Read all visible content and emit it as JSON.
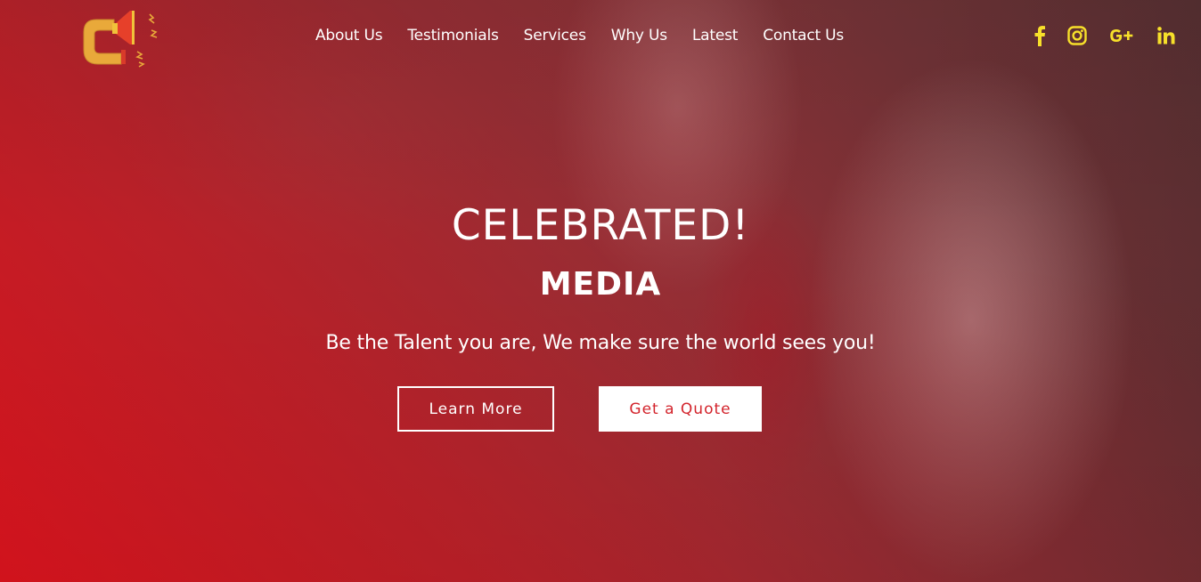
{
  "brand": {
    "logo_icon": "megaphone-c-logo-icon",
    "logo_colors": [
      "#e9a93a",
      "#d93a2a"
    ]
  },
  "nav": {
    "items": [
      {
        "label": "About Us"
      },
      {
        "label": "Testimonials"
      },
      {
        "label": "Services"
      },
      {
        "label": "Why Us"
      },
      {
        "label": "Latest"
      },
      {
        "label": "Contact Us"
      }
    ]
  },
  "social": {
    "color": "#f7e02a",
    "icons": [
      "facebook-icon",
      "instagram-icon",
      "google-plus-icon",
      "linkedin-icon"
    ]
  },
  "hero": {
    "title": "CELEBRATED!",
    "subtitle": "MEDIA",
    "tagline": "Be the Talent you are, We make sure the world sees you!",
    "primary_button": "Learn More",
    "secondary_button": "Get a Quote",
    "accent_color": "#d3242c",
    "overlay_color": "#e1121c"
  }
}
